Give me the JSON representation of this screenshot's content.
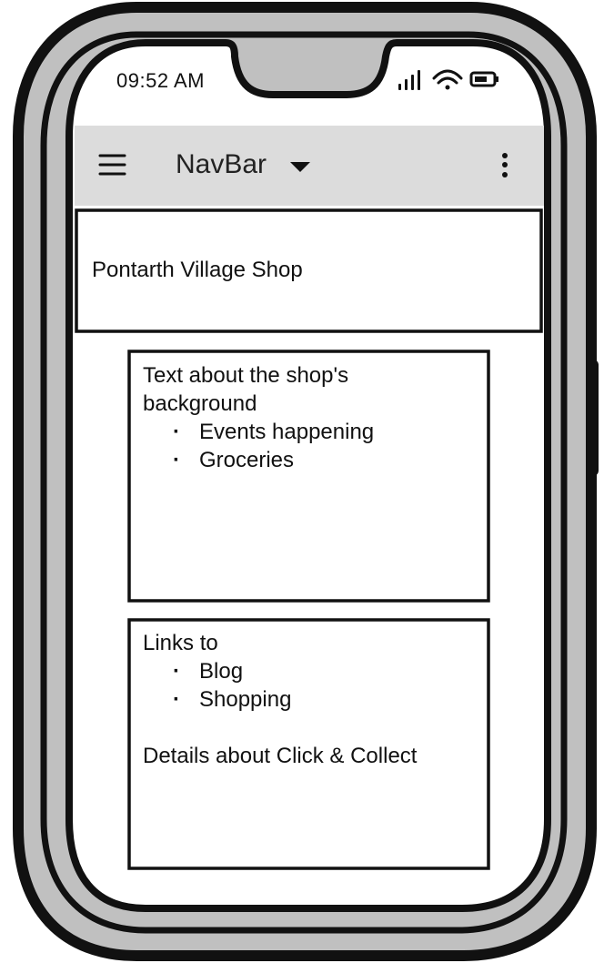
{
  "status_bar": {
    "time": "09:52 AM",
    "icons": [
      "signal-icon",
      "wifi-icon",
      "battery-icon"
    ]
  },
  "navbar": {
    "menu_icon": "hamburger-menu-icon",
    "title": "NavBar",
    "dropdown_icon": "caret-down-icon",
    "more_icon": "vertical-dots-icon"
  },
  "header_box": {
    "title": "Pontarth Village Shop"
  },
  "background_panel": {
    "text_line1": "Text about the shop's",
    "text_line2": "background",
    "bullets": [
      "Events happening",
      "Groceries"
    ]
  },
  "links_panel": {
    "heading": "Links to",
    "bullets": [
      "Blog",
      "Shopping"
    ],
    "details": "Details about Click & Collect"
  },
  "colors": {
    "frame_gray": "#c0c0c0",
    "navbar_bg": "#dcdcdc",
    "stroke": "#111111",
    "screen_bg": "#ffffff"
  }
}
